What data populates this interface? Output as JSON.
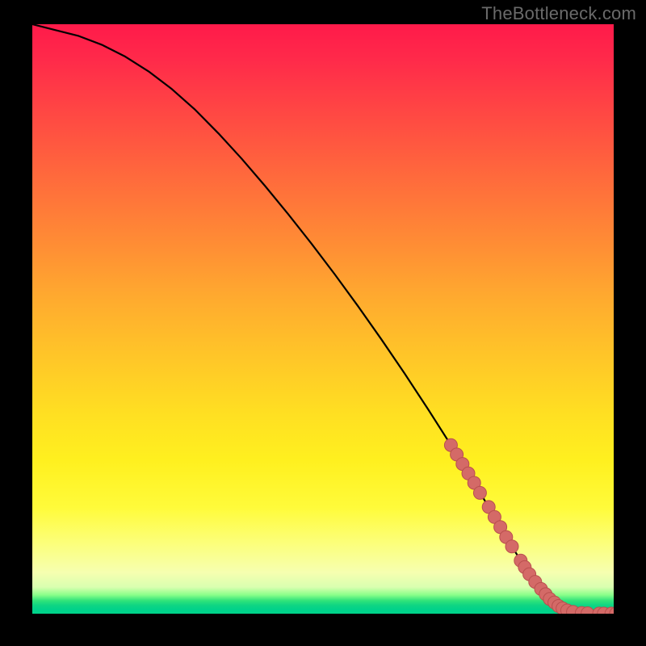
{
  "watermark": "TheBottleneck.com",
  "colors": {
    "background": "#000000",
    "curve": "#000000",
    "marker_fill": "#d46a67",
    "marker_stroke": "#b94f4e"
  },
  "chart_data": {
    "type": "line",
    "title": "",
    "xlabel": "",
    "ylabel": "",
    "xlim": [
      0,
      100
    ],
    "ylim": [
      0,
      100
    ],
    "grid": false,
    "legend": false,
    "series": [
      {
        "name": "bottleneck-curve",
        "x": [
          0,
          4,
          8,
          12,
          16,
          20,
          24,
          28,
          32,
          36,
          40,
          44,
          48,
          52,
          56,
          60,
          64,
          68,
          72,
          76,
          80,
          83,
          85,
          87,
          88,
          90,
          92,
          94,
          96,
          98,
          100
        ],
        "y": [
          100,
          99,
          98,
          96.5,
          94.5,
          92,
          89,
          85.5,
          81.5,
          77.2,
          72.6,
          67.8,
          62.8,
          57.6,
          52.2,
          46.6,
          40.8,
          34.8,
          28.6,
          22.2,
          15.6,
          10.6,
          7.4,
          4.8,
          3.6,
          1.8,
          0.8,
          0.25,
          0.08,
          0.02,
          0.0
        ]
      }
    ],
    "markers": [
      {
        "x": 72.0,
        "y": 28.6
      },
      {
        "x": 73.0,
        "y": 27.0
      },
      {
        "x": 74.0,
        "y": 25.4
      },
      {
        "x": 75.0,
        "y": 23.8
      },
      {
        "x": 76.0,
        "y": 22.2
      },
      {
        "x": 77.0,
        "y": 20.5
      },
      {
        "x": 78.5,
        "y": 18.1
      },
      {
        "x": 79.5,
        "y": 16.4
      },
      {
        "x": 80.5,
        "y": 14.7
      },
      {
        "x": 81.5,
        "y": 13.0
      },
      {
        "x": 82.5,
        "y": 11.4
      },
      {
        "x": 84.0,
        "y": 9.0
      },
      {
        "x": 84.7,
        "y": 7.9
      },
      {
        "x": 85.5,
        "y": 6.7
      },
      {
        "x": 86.5,
        "y": 5.4
      },
      {
        "x": 87.5,
        "y": 4.2
      },
      {
        "x": 88.3,
        "y": 3.3
      },
      {
        "x": 89.0,
        "y": 2.5
      },
      {
        "x": 89.8,
        "y": 1.9
      },
      {
        "x": 90.5,
        "y": 1.3
      },
      {
        "x": 91.2,
        "y": 0.9
      },
      {
        "x": 92.0,
        "y": 0.55
      },
      {
        "x": 93.0,
        "y": 0.3
      },
      {
        "x": 94.5,
        "y": 0.12
      },
      {
        "x": 95.5,
        "y": 0.06
      },
      {
        "x": 97.5,
        "y": 0.02
      },
      {
        "x": 98.3,
        "y": 0.015
      },
      {
        "x": 99.6,
        "y": 0.01
      },
      {
        "x": 100.4,
        "y": 0.01
      }
    ]
  }
}
